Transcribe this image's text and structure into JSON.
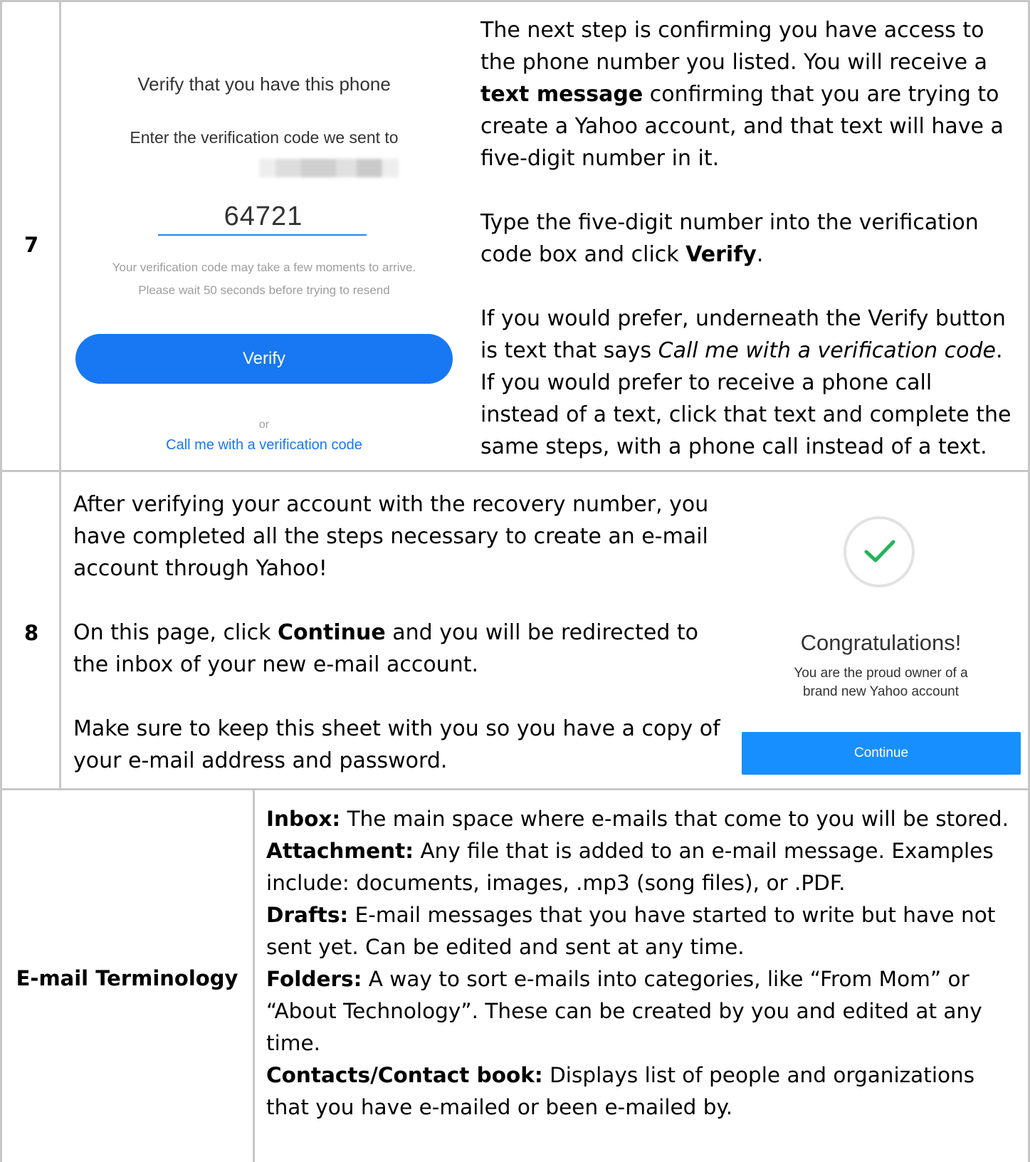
{
  "row7": {
    "number": "7",
    "screenshot": {
      "title": "Verify that you have this phone",
      "subtitle": "Enter the verification code we sent to",
      "code_value": "64721",
      "note_line1": "Your verification code may take a few moments to arrive.",
      "note_line2": "Please wait 50 seconds before trying to resend",
      "verify_label": "Verify",
      "or_label": "or",
      "call_link": "Call me with a verification code"
    },
    "text": {
      "p1_a": "The next step is confirming you have access to the phone number you listed. You will receive a ",
      "p1_bold": "text message",
      "p1_b": " confirming that you are trying to create a Yahoo account, and that text will have a five-digit number in it.",
      "p2_a": "Type the five-digit number into the verification code box and click ",
      "p2_bold": "Verify",
      "p2_b": ".",
      "p3_a": "If you would prefer, underneath the Verify button is text that says ",
      "p3_italic": "Call me with a verification code",
      "p3_b": ". If you would prefer to receive a phone call instead of a text, click that text and complete the same steps, with a phone call instead of a text."
    }
  },
  "row8": {
    "number": "8",
    "text": {
      "p1": "After verifying your account with the recovery number, you have completed all the steps necessary to create an e-mail account through Yahoo!",
      "p2_a": "On this page, click ",
      "p2_bold": "Continue",
      "p2_b": " and you will be redirected to the inbox of your new e-mail account.",
      "p3": "Make sure to keep this sheet with you so you have a copy of your e-mail address and password."
    },
    "screenshot": {
      "icon": "checkmark-icon",
      "title": "Congratulations!",
      "subtitle_line1": "You are the proud owner of a",
      "subtitle_line2": "brand new Yahoo account",
      "continue_label": "Continue"
    }
  },
  "terminology": {
    "label": "E-mail Terminology",
    "items": [
      {
        "term": "Inbox:",
        "definition": " The main space where e-mails that come to you will be stored."
      },
      {
        "term": "Attachment:",
        "definition": " Any file that is added to an e-mail message. Examples include: documents, images, .mp3 (song files), or .PDF."
      },
      {
        "term": "Drafts:",
        "definition": " E-mail messages that you have started to write but have not sent yet. Can be edited and sent at any time."
      },
      {
        "term": "Folders:",
        "definition": " A way to sort e-mails into categories, like “From Mom” or “About Technology”. These can be created by you and edited at any time."
      },
      {
        "term": "Contacts/Contact book:",
        "definition": " Displays list of people and organizations that you have e-mailed or been e-mailed by."
      }
    ]
  },
  "colors": {
    "accent_blue": "#1877f2",
    "continue_blue": "#188fff",
    "check_green": "#26b35a",
    "border_gray": "#c7c7c7"
  }
}
